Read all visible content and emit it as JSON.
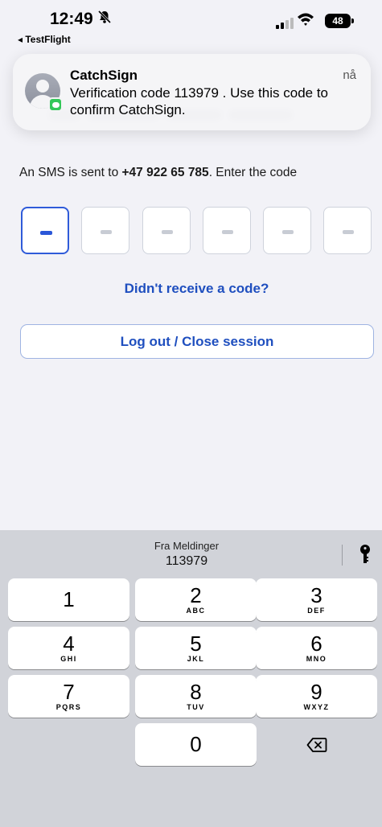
{
  "status_bar": {
    "time": "12:49",
    "bell_icon": "bell-slash-icon",
    "back_app": "◂ TestFlight",
    "battery": "48"
  },
  "notification": {
    "app_name": "CatchSign",
    "time": "nå",
    "message": "Verification code 113979 . Use this code to confirm CatchSign."
  },
  "main": {
    "sms_prefix": "An SMS is sent to ",
    "phone": "+47 922 65 785",
    "sms_suffix": ". Enter the code",
    "code_box_count": 6,
    "resend_label": "Didn't receive a code?",
    "logout_label": "Log out / Close session"
  },
  "keyboard": {
    "suggestion_source": "Fra Meldinger",
    "suggestion_code": "113979",
    "keys": [
      {
        "num": "1",
        "letters": ""
      },
      {
        "num": "2",
        "letters": "ABC"
      },
      {
        "num": "3",
        "letters": "DEF"
      },
      {
        "num": "4",
        "letters": "GHI"
      },
      {
        "num": "5",
        "letters": "JKL"
      },
      {
        "num": "6",
        "letters": "MNO"
      },
      {
        "num": "7",
        "letters": "PQRS"
      },
      {
        "num": "8",
        "letters": "TUV"
      },
      {
        "num": "9",
        "letters": "WXYZ"
      },
      {
        "num": "0",
        "letters": ""
      }
    ]
  },
  "colors": {
    "accent": "#1f4fbf",
    "active_border": "#2f5bd9",
    "background": "#f2f2f7",
    "keyboard": "#d1d3d9"
  }
}
